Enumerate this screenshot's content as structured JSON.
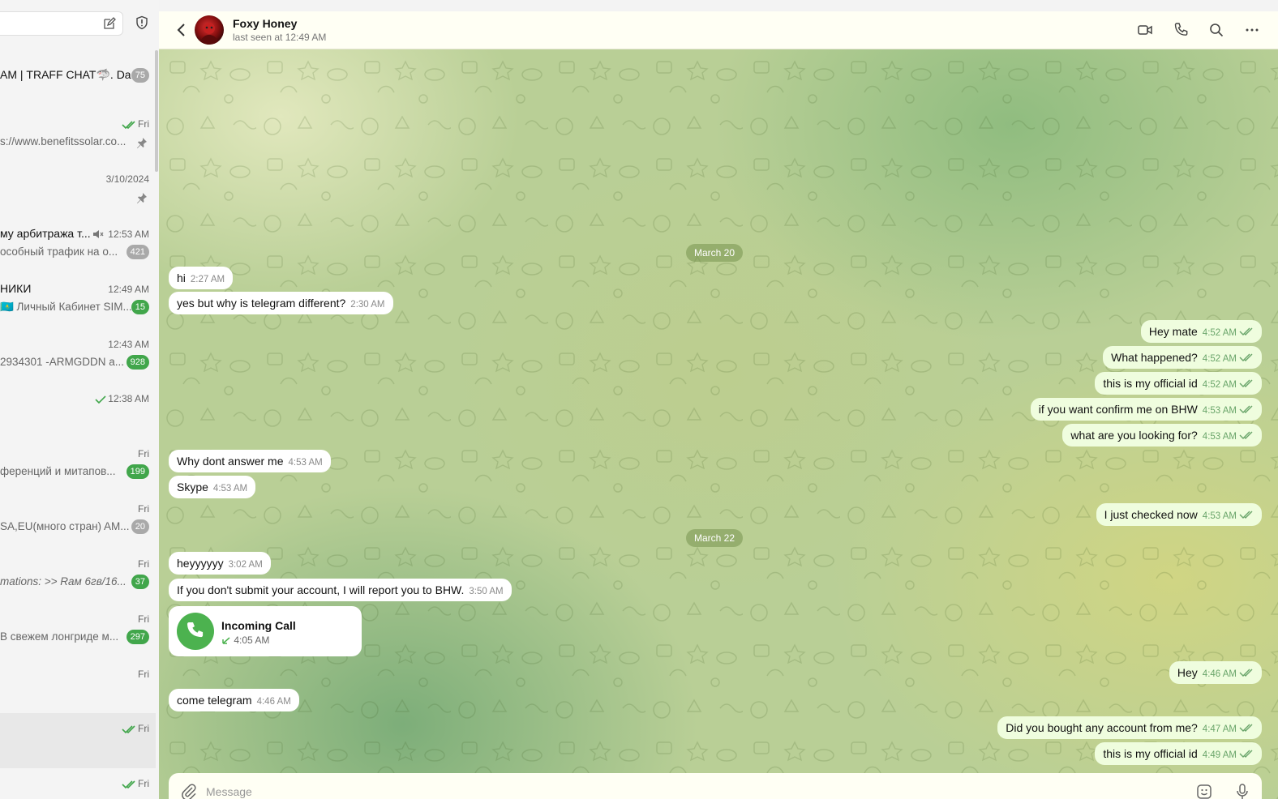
{
  "sidebar": {
    "chats": [
      {
        "title": "АМ | TRAFF CHAT🦈. Da...",
        "time": "",
        "preview": "",
        "badge": "75",
        "muted": true,
        "pinned": false,
        "read": false
      },
      {
        "title": "",
        "time": "Fri",
        "preview": "s://www.benefitssolar.co...",
        "badge": "",
        "muted": false,
        "pinned": true,
        "read": true
      },
      {
        "title": "",
        "time": "3/10/2024",
        "preview": "",
        "badge": "",
        "muted": false,
        "pinned": true,
        "read": false
      },
      {
        "title": "му арбитража т...",
        "time": "12:53 AM",
        "preview": "особный трафик на о...",
        "badge": "421",
        "muted": true,
        "pinned": false,
        "read": false,
        "mute_icon": true
      },
      {
        "title": "НИКИ",
        "time": "12:49 AM",
        "preview": "🇰🇿 Личный Кабинет SIM...",
        "badge": "15",
        "muted": false,
        "pinned": false,
        "read": false
      },
      {
        "title": "",
        "time": "12:43 AM",
        "preview": "2934301 -ARMGDDN a...",
        "badge": "928",
        "muted": false,
        "pinned": false,
        "read": false
      },
      {
        "title": "",
        "time": "12:38 AM",
        "preview": "",
        "badge": "",
        "muted": false,
        "pinned": false,
        "read": true,
        "single_check": true
      },
      {
        "title": "",
        "time": "Fri",
        "preview": "ференций и митапов...",
        "badge": "199",
        "muted": false,
        "pinned": false,
        "read": false
      },
      {
        "title": "",
        "time": "Fri",
        "preview": "SA,EU(много стран) AM...",
        "badge": "20",
        "muted": true,
        "pinned": false,
        "read": false
      },
      {
        "title": "",
        "time": "Fri",
        "preview": "mations: >> Rам 6гв/16...",
        "preview_italic": true,
        "badge": "37",
        "muted": false,
        "pinned": false,
        "read": false
      },
      {
        "title": "",
        "time": "Fri",
        "preview": "В свежем лонгриде м...",
        "badge": "297",
        "muted": false,
        "pinned": false,
        "read": false
      },
      {
        "title": "",
        "time": "Fri",
        "preview": "",
        "badge": "",
        "muted": false,
        "pinned": false,
        "read": false
      },
      {
        "title": "",
        "time": "Fri",
        "preview": "",
        "badge": "",
        "muted": false,
        "pinned": false,
        "read": true,
        "active": true
      },
      {
        "title": "",
        "time": "Fri",
        "preview": "",
        "badge": "",
        "muted": false,
        "pinned": false,
        "read": true
      }
    ]
  },
  "header": {
    "name": "Foxy Honey",
    "status": "last seen at 12:49 AM"
  },
  "dates": [
    "March 20",
    "March 22"
  ],
  "messages": [
    {
      "dir": "in",
      "text": "hi",
      "time": "2:27 AM"
    },
    {
      "dir": "in",
      "text": "yes but why is telegram different?",
      "time": "2:30 AM"
    },
    {
      "dir": "out",
      "text": "Hey mate",
      "time": "4:52 AM"
    },
    {
      "dir": "out",
      "text": "What happened?",
      "time": "4:52 AM"
    },
    {
      "dir": "out",
      "text": "this is my official id",
      "time": "4:52 AM"
    },
    {
      "dir": "out",
      "text": "if you want confirm me on BHW",
      "time": "4:53 AM"
    },
    {
      "dir": "out",
      "text": "what are you looking for?",
      "time": "4:53 AM"
    },
    {
      "dir": "in",
      "text": "Why dont answer me",
      "time": "4:53 AM"
    },
    {
      "dir": "in",
      "text": "Skype",
      "time": "4:53 AM"
    },
    {
      "dir": "out",
      "text": "I just checked now",
      "time": "4:53 AM"
    },
    {
      "dir": "in",
      "text": "heyyyyyy",
      "time": "3:02 AM"
    },
    {
      "dir": "in",
      "text": "If you don't submit your account, I will report you to BHW.",
      "time": "3:50 AM"
    },
    {
      "dir": "out",
      "text": "Hey",
      "time": "4:46 AM"
    },
    {
      "dir": "in",
      "text": "come telegram",
      "time": "4:46 AM"
    },
    {
      "dir": "out",
      "text": "Did you bought any account from me?",
      "time": "4:47 AM"
    },
    {
      "dir": "out",
      "text": "this is my official id",
      "time": "4:49 AM"
    }
  ],
  "call": {
    "title": "Incoming Call",
    "time": "4:05 AM"
  },
  "composer": {
    "placeholder": "Message"
  },
  "colors": {
    "accent": "#41a64b",
    "out_bubble": "#effdde",
    "header_bg": "#fffff4"
  }
}
